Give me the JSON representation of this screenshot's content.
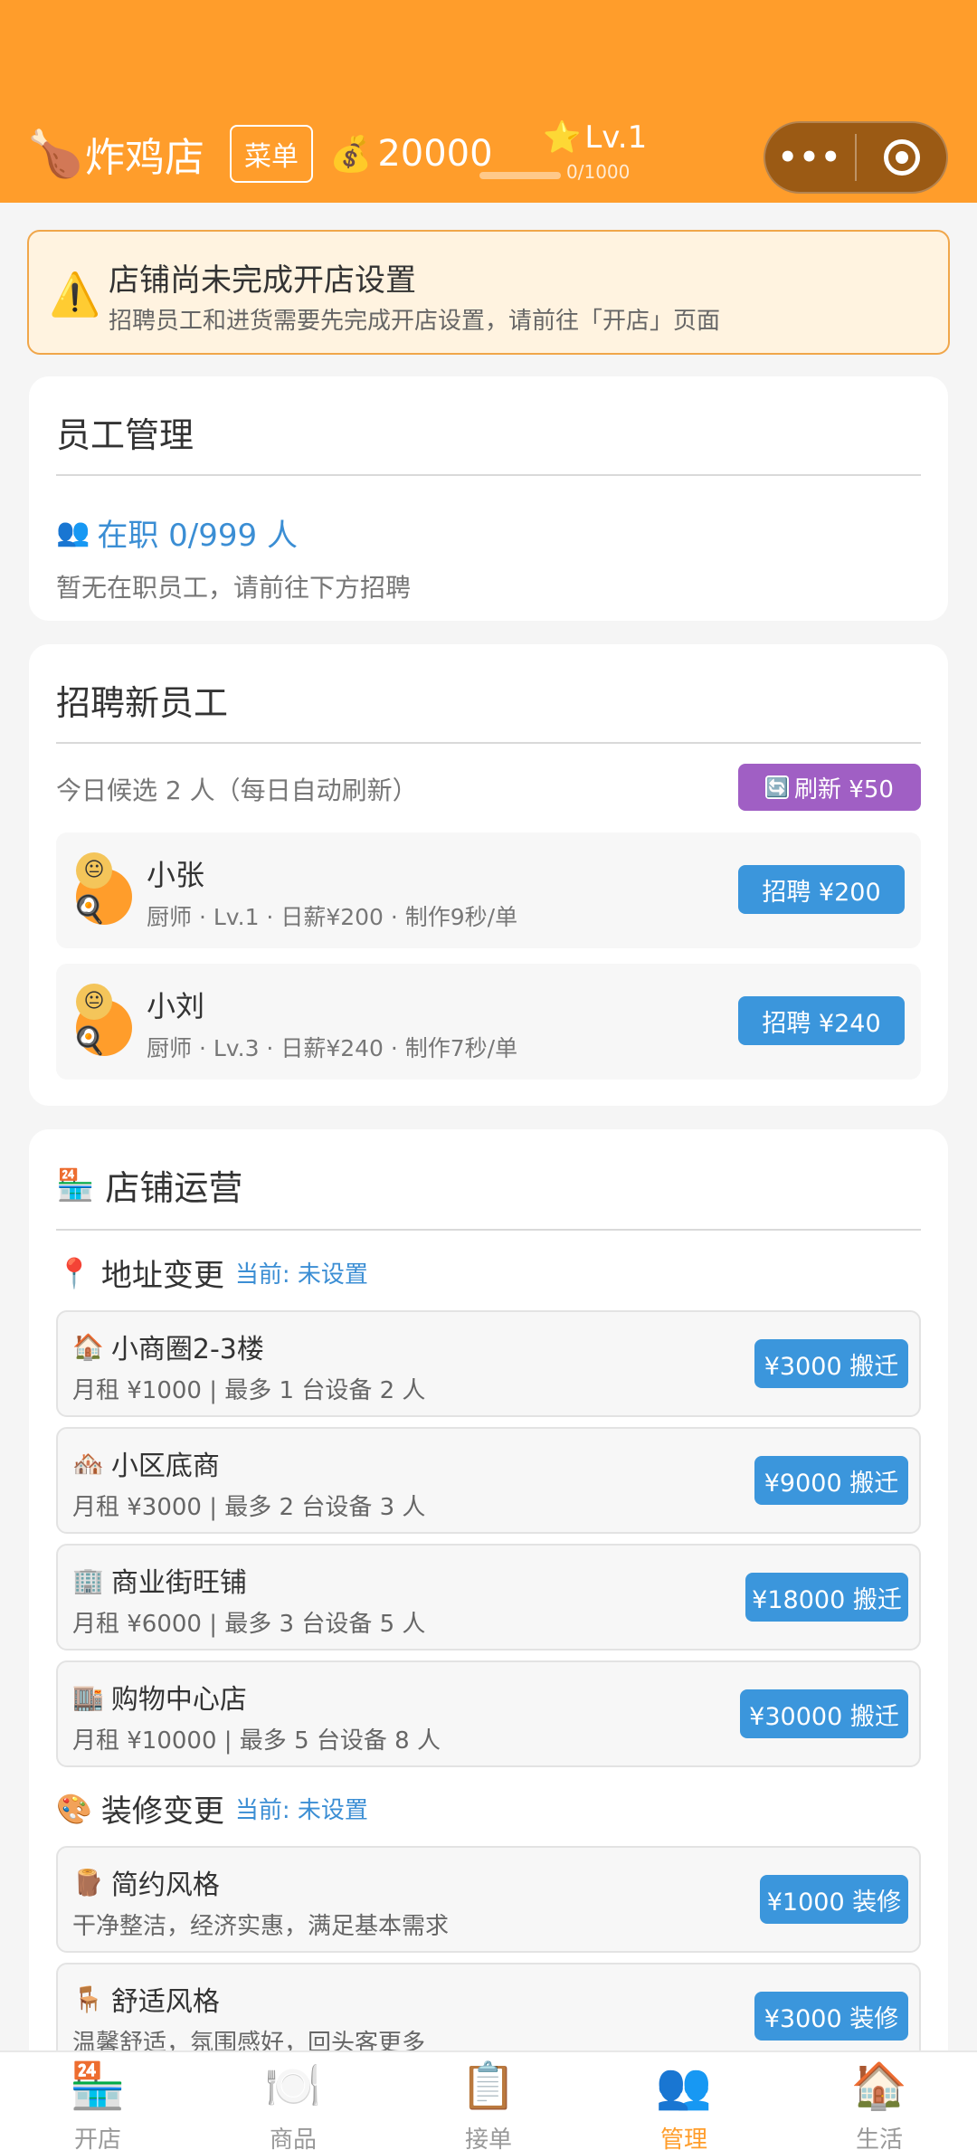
{
  "header": {
    "shop_icon": "🍗",
    "shop_name": "炸鸡店",
    "menu_label": "菜单",
    "money_icon": "💰",
    "money": "20000",
    "star_icon": "⭐",
    "level": "Lv.1",
    "xp": "0/1000",
    "xp_progress": 0,
    "capsule_more": "•••"
  },
  "warning": {
    "icon": "⚠️",
    "title": "店铺尚未完成开店设置",
    "desc": "招聘员工和进货需要先完成开店设置，请前往「开店」页面"
  },
  "staff": {
    "title": "员工管理",
    "icon": "👥",
    "count": "在职 0/999 人",
    "empty": "暂无在职员工，请前往下方招聘"
  },
  "recruit": {
    "title": "招聘新员工",
    "info": "今日候选 2 人（每日自动刷新）",
    "refresh_icon": "🔄",
    "refresh_label": "刷新 ¥50",
    "candidates": [
      {
        "name": "小张",
        "desc": "厨师 · Lv.1 · 日薪¥200 · 制作9秒/单",
        "button": "招聘 ¥200"
      },
      {
        "name": "小刘",
        "desc": "厨师 · Lv.3 · 日薪¥240 · 制作7秒/单",
        "button": "招聘 ¥240"
      }
    ]
  },
  "operations": {
    "icon": "🏪",
    "title": "店铺运营",
    "address": {
      "icon": "📍",
      "title": "地址变更",
      "current": "当前: 未设置",
      "options": [
        {
          "icon": "🏠",
          "name": "小商圈2-3楼",
          "desc": "月租 ¥1000 | 最多 1 台设备 2 人",
          "button": "¥3000 搬迁"
        },
        {
          "icon": "🏘️",
          "name": "小区底商",
          "desc": "月租 ¥3000 | 最多 2 台设备 3 人",
          "button": "¥9000 搬迁"
        },
        {
          "icon": "🏢",
          "name": "商业街旺铺",
          "desc": "月租 ¥6000 | 最多 3 台设备 5 人",
          "button": "¥18000 搬迁"
        },
        {
          "icon": "🏬",
          "name": "购物中心店",
          "desc": "月租 ¥10000 | 最多 5 台设备 8 人",
          "button": "¥30000 搬迁"
        }
      ]
    },
    "decoration": {
      "icon": "🎨",
      "title": "装修变更",
      "current": "当前: 未设置",
      "options": [
        {
          "icon": "🪵",
          "name": "简约风格",
          "desc": "干净整洁，经济实惠，满足基本需求",
          "button": "¥1000 装修"
        },
        {
          "icon": "🪑",
          "name": "舒适风格",
          "desc": "温馨舒适，氛围感好，回头客更多",
          "button": "¥3000 装修"
        }
      ]
    }
  },
  "tabs": [
    {
      "icon": "🏪",
      "label": "开店"
    },
    {
      "icon": "🍽️",
      "label": "商品"
    },
    {
      "icon": "📋",
      "label": "接单"
    },
    {
      "icon": "👥",
      "label": "管理"
    },
    {
      "icon": "🏠",
      "label": "生活"
    }
  ],
  "colors": {
    "header": "#ff9d2b",
    "accent_blue": "#3b96dc",
    "refresh_purple": "#a05fc4",
    "active_tab": "#ff9d2b"
  }
}
